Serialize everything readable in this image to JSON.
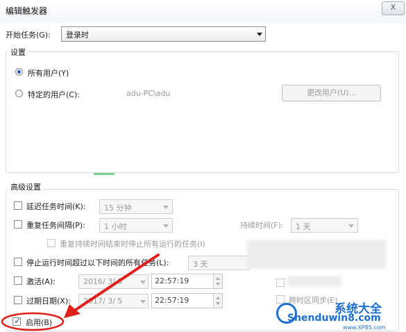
{
  "dialog": {
    "title": "编辑触发器",
    "close_label": "X"
  },
  "begin_task": {
    "label": "开始任务(G):",
    "value": "登录时"
  },
  "settings": {
    "group_label": "设置",
    "all_users": "所有用户(Y)",
    "specific_user": "特定的用户(C):",
    "user_name": "adu-PC\\adu",
    "change_user_button": "更改用户(U)..."
  },
  "advanced": {
    "group_label": "高级设置",
    "delay_task": {
      "label": "延迟任务时间(K):",
      "value": "15 分钟"
    },
    "repeat_task": {
      "label": "重复任务间隔(P):",
      "value": "1 小时"
    },
    "duration": {
      "label": "持续时间(F):",
      "value": "1 天"
    },
    "stop_all_running": "重复持续时间结束时停止所有运行的任务(I)",
    "stop_if_longer": {
      "label": "停止运行时间超过以下时间的所有任务(L):",
      "value": "3 天"
    },
    "activate": {
      "label": "激活(A):",
      "date": "2016/ 3/ 5",
      "time": "22:57:19"
    },
    "expire": {
      "label": "过期日期(X):",
      "date": "2017/ 3/ 5",
      "time": "22:57:19"
    },
    "sync_timezones": "跨时区同步(E)",
    "enabled": {
      "label": "启用(B)",
      "checked": true
    }
  },
  "watermark": {
    "text": "Shenduwin8.com",
    "sub": "www.XP85.com",
    "badge": "系统大全"
  },
  "colors": {
    "annotation_red": "#e0211b",
    "accent": "#2a5fc2",
    "watermark_blue": "#1c6fd0"
  }
}
